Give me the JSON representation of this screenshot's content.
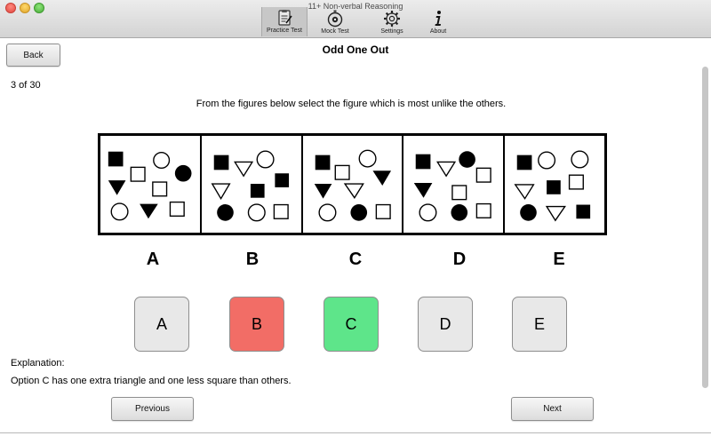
{
  "window": {
    "title": "11+ Non-verbal Reasoning"
  },
  "toolbar": {
    "items": [
      {
        "label": "Practice Test",
        "icon": "clipboard-icon",
        "active": true
      },
      {
        "label": "Mock Test",
        "icon": "stopwatch-icon",
        "active": false
      },
      {
        "label": "Settings",
        "icon": "gear-icon",
        "active": false
      },
      {
        "label": "About",
        "icon": "info-icon",
        "active": false
      }
    ]
  },
  "page": {
    "back_label": "Back",
    "title": "Odd One Out",
    "counter": "3 of 30",
    "instruction": "From the figures below select the figure which is most unlike the others."
  },
  "figure_labels": [
    "A",
    "B",
    "C",
    "D",
    "E"
  ],
  "answers": [
    {
      "label": "A",
      "state": "default"
    },
    {
      "label": "B",
      "state": "incorrect"
    },
    {
      "label": "C",
      "state": "correct"
    },
    {
      "label": "D",
      "state": "default"
    },
    {
      "label": "E",
      "state": "default"
    }
  ],
  "colors": {
    "incorrect": "#f26d66",
    "correct": "#5ee58a",
    "default": "#e8e8e8"
  },
  "explanation": {
    "title": "Explanation:",
    "text": "Option C has one extra triangle and one less square than others."
  },
  "nav": {
    "previous_label": "Previous",
    "next_label": "Next"
  }
}
